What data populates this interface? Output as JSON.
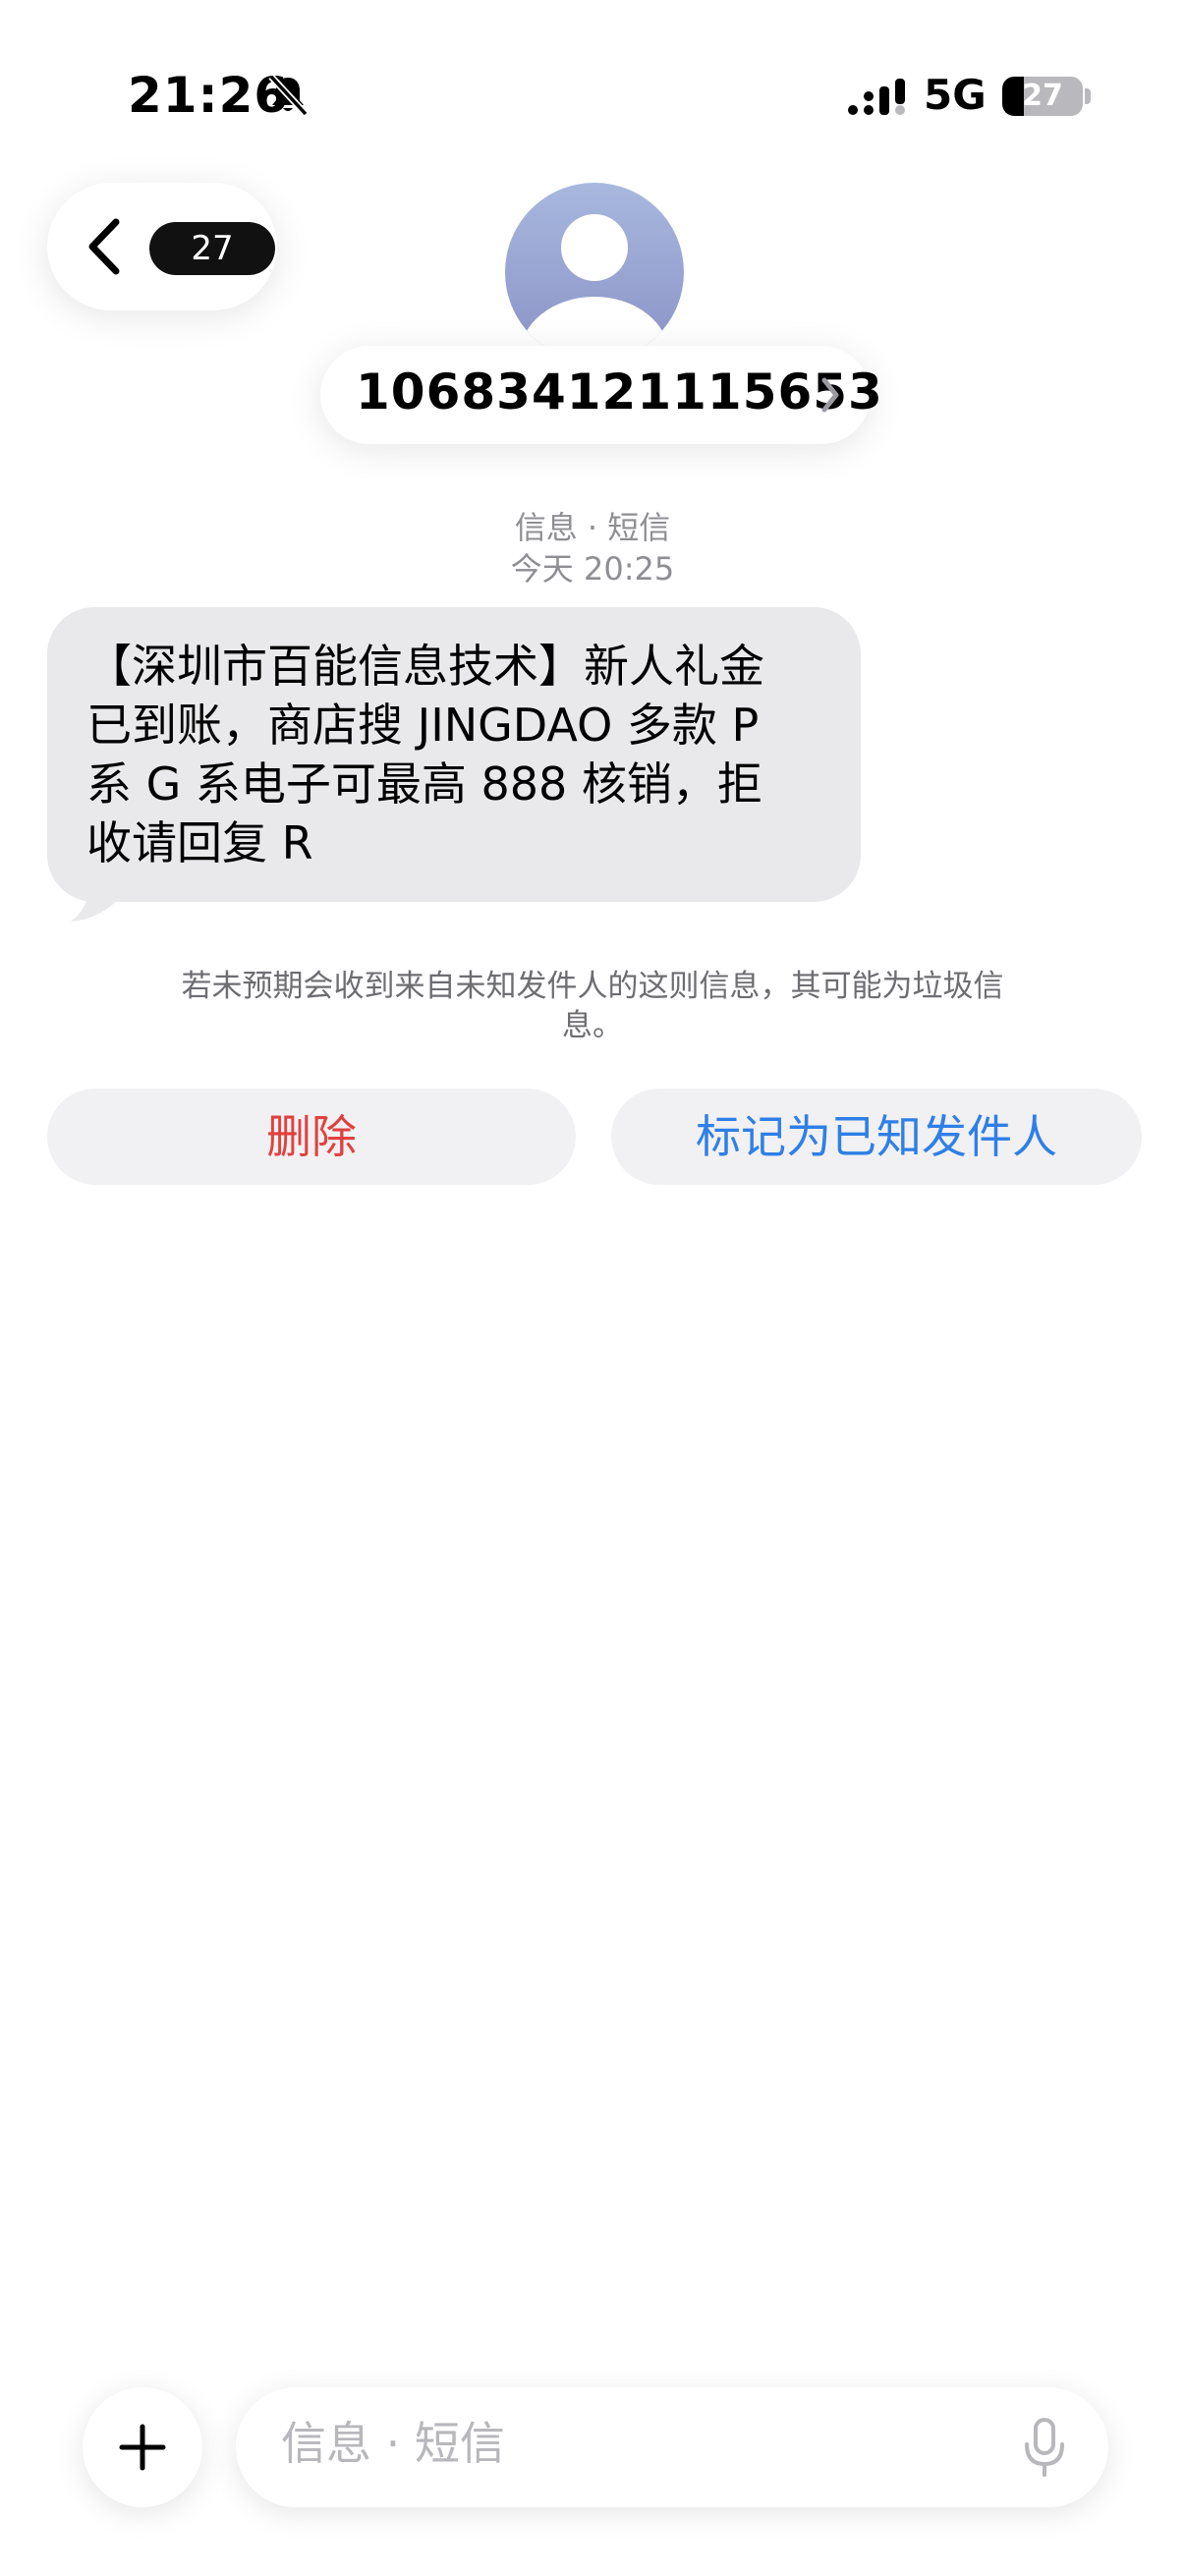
{
  "status_bar": {
    "time": "21:26",
    "network": "5G",
    "battery_level": "27",
    "battery_fraction": 0.27
  },
  "header": {
    "back_badge": "27",
    "sender": "106834121115653"
  },
  "meta": {
    "service": "信息 · 短信",
    "time": "今天 20:25"
  },
  "message": {
    "text": "【深圳市百能信息技术】新人礼金\n已到账，商店搜 JINGDAO 多款 P\n系 G 系电子可最高 888 核销，拒\n收请回复 R"
  },
  "warning": "若未预期会收到来自未知发件人的这则信息，其可能为垃圾信息。",
  "actions": {
    "delete": "删除",
    "mark_known": "标记为已知发件人"
  },
  "composer": {
    "placeholder": "信息 · 短信",
    "value": ""
  },
  "colors": {
    "delete": "#e0413f",
    "accent": "#2f7fe6",
    "bubble": "#e9e9eb"
  },
  "icons": {
    "status_silent": "bell-slash-icon",
    "signal": "cellular-signal-icon",
    "back": "chevron-left-icon",
    "avatar": "person-icon",
    "sender_detail": "chevron-right-icon",
    "add": "plus-icon",
    "dictation": "microphone-icon"
  }
}
